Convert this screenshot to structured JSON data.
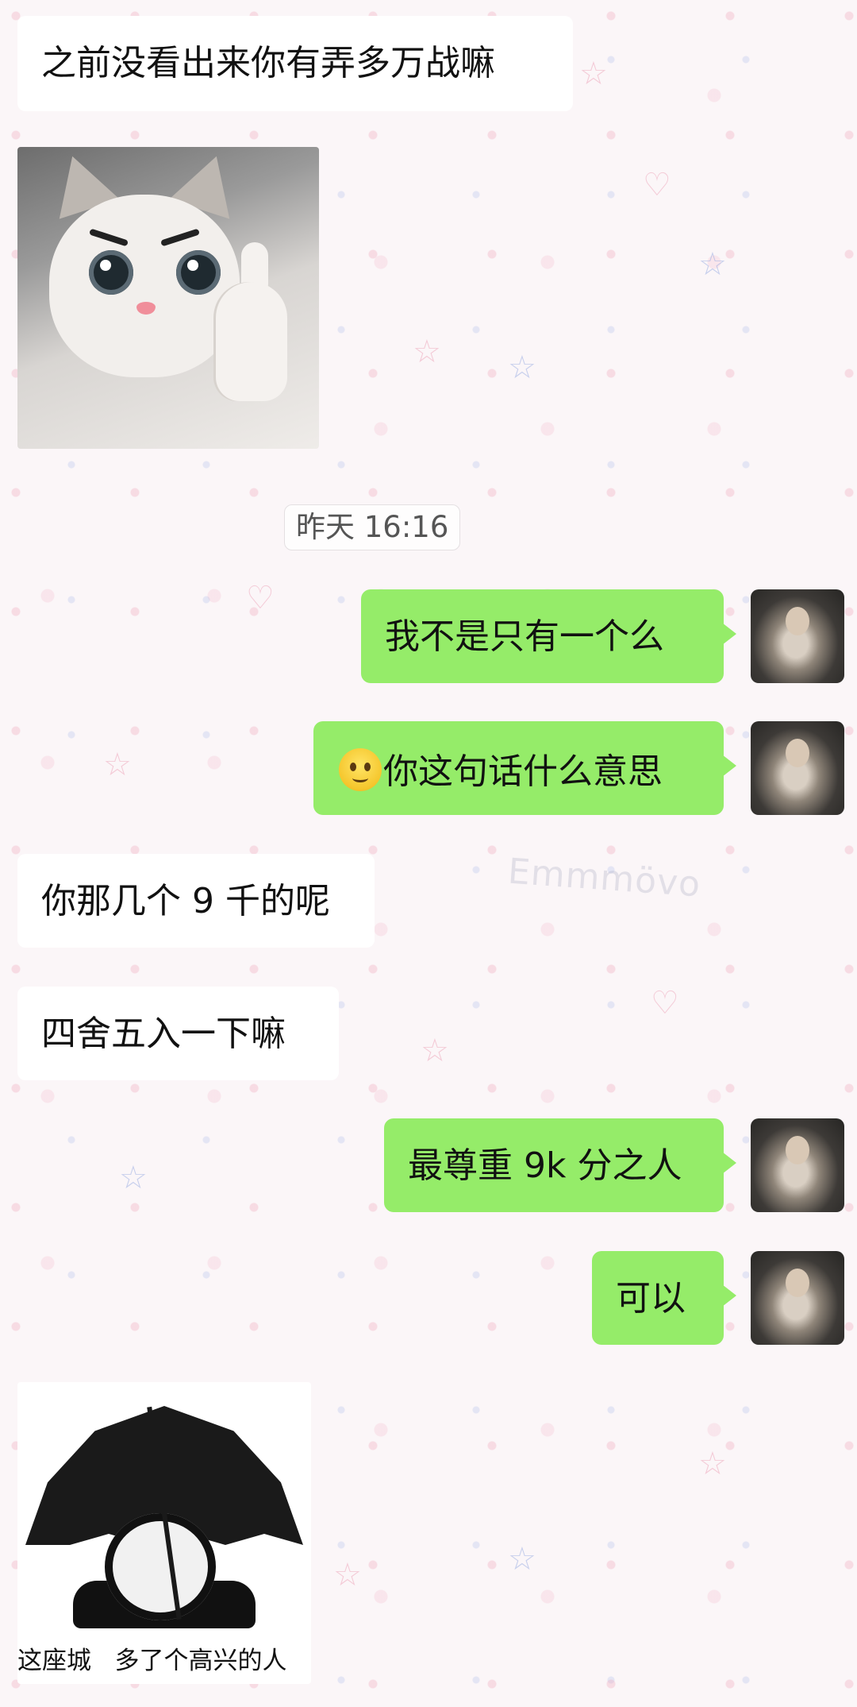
{
  "chat": {
    "messages": [
      {
        "side": "incoming",
        "type": "text",
        "text": "之前没看出来你有弄多万战嘛"
      },
      {
        "side": "incoming",
        "type": "sticker",
        "sticker_name": "cat-thumbs-up-sticker"
      },
      {
        "side": "system",
        "type": "timestamp",
        "text": "昨天 16:16"
      },
      {
        "side": "outgoing",
        "type": "text",
        "text": "我不是只有一个么"
      },
      {
        "side": "outgoing",
        "type": "text",
        "emoji": "smile-emoji",
        "text": "你这句话什么意思"
      },
      {
        "side": "incoming",
        "type": "text",
        "text": "你那几个 9 千的呢"
      },
      {
        "side": "incoming",
        "type": "text",
        "text": "四舍五入一下嘛"
      },
      {
        "side": "outgoing",
        "type": "text",
        "text": "最尊重 9k 分之人"
      },
      {
        "side": "outgoing",
        "type": "text",
        "text": "可以"
      },
      {
        "side": "incoming",
        "type": "sticker",
        "sticker_name": "panda-umbrella-sticker",
        "caption": "这座城   多了个高兴的人"
      }
    ]
  },
  "wallpaper": {
    "watermark": "Emmmövo"
  },
  "colors": {
    "outgoing_bubble": "#95ec69",
    "incoming_bubble": "#ffffff",
    "background": "#fbf6f8"
  }
}
